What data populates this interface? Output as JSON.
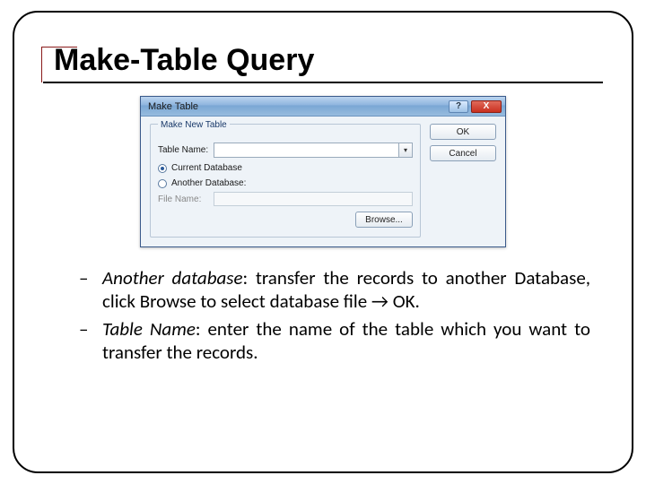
{
  "title": "Make-Table Query",
  "dialog": {
    "window_title": "Make Table",
    "help_glyph": "?",
    "close_glyph": "X",
    "group_label": "Make New Table",
    "table_name_label": "Table Name:",
    "combo_value": "",
    "combo_arrow": "▾",
    "radio_current": "Current Database",
    "radio_another": "Another Database:",
    "file_name_label": "File Name:",
    "file_value": "",
    "browse_label": "Browse...",
    "ok_label": "OK",
    "cancel_label": "Cancel"
  },
  "bullets": {
    "b1_em": "Another database",
    "b1_rest": ": transfer the records to another Database, click Browse to select database file → OK.",
    "b2_em": "Table Name",
    "b2_rest": ": enter the name of the table which you want to transfer the records."
  }
}
